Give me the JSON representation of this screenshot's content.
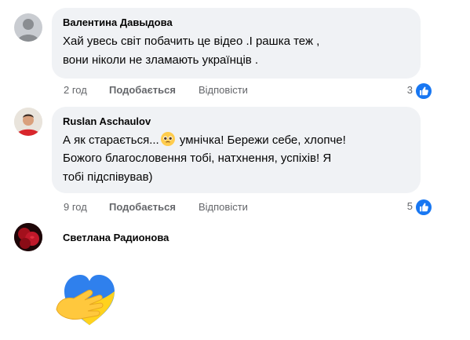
{
  "comments": [
    {
      "author": "Валентина Давыдова",
      "text_line1": "Хай увесь світ побачить це відео .І рашка теж ,",
      "text_line2": "вони ніколи не зламають українців .",
      "time": "2 год",
      "like_label": "Подобається",
      "reply_label": "Відповісти",
      "reaction_count": "3",
      "reaction_icon": "like-icon"
    },
    {
      "author": "Ruslan Aschaulov",
      "text_line1_before": "А як старається...",
      "text_line1_emoji": "pleading-face-emoji",
      "text_line1_after": " умнічка! Бережи себе, хлопче!",
      "text_line2": "Божого благословення тобі, натхнення, успіхів! Я",
      "text_line3": "тобі підспівував)",
      "time": "9 год",
      "like_label": "Подобається",
      "reply_label": "Відповісти",
      "reaction_count": "5",
      "reaction_icon": "like-icon"
    },
    {
      "author": "Светлана Радионова",
      "sticker": "hand-with-blue-yellow-heart-sticker"
    }
  ],
  "colors": {
    "bubble": "#f0f2f5",
    "meta_text": "#65676b",
    "like_blue": "#1877f2",
    "heart_blue": "#2f80ed",
    "heart_yellow": "#ffd21e"
  }
}
